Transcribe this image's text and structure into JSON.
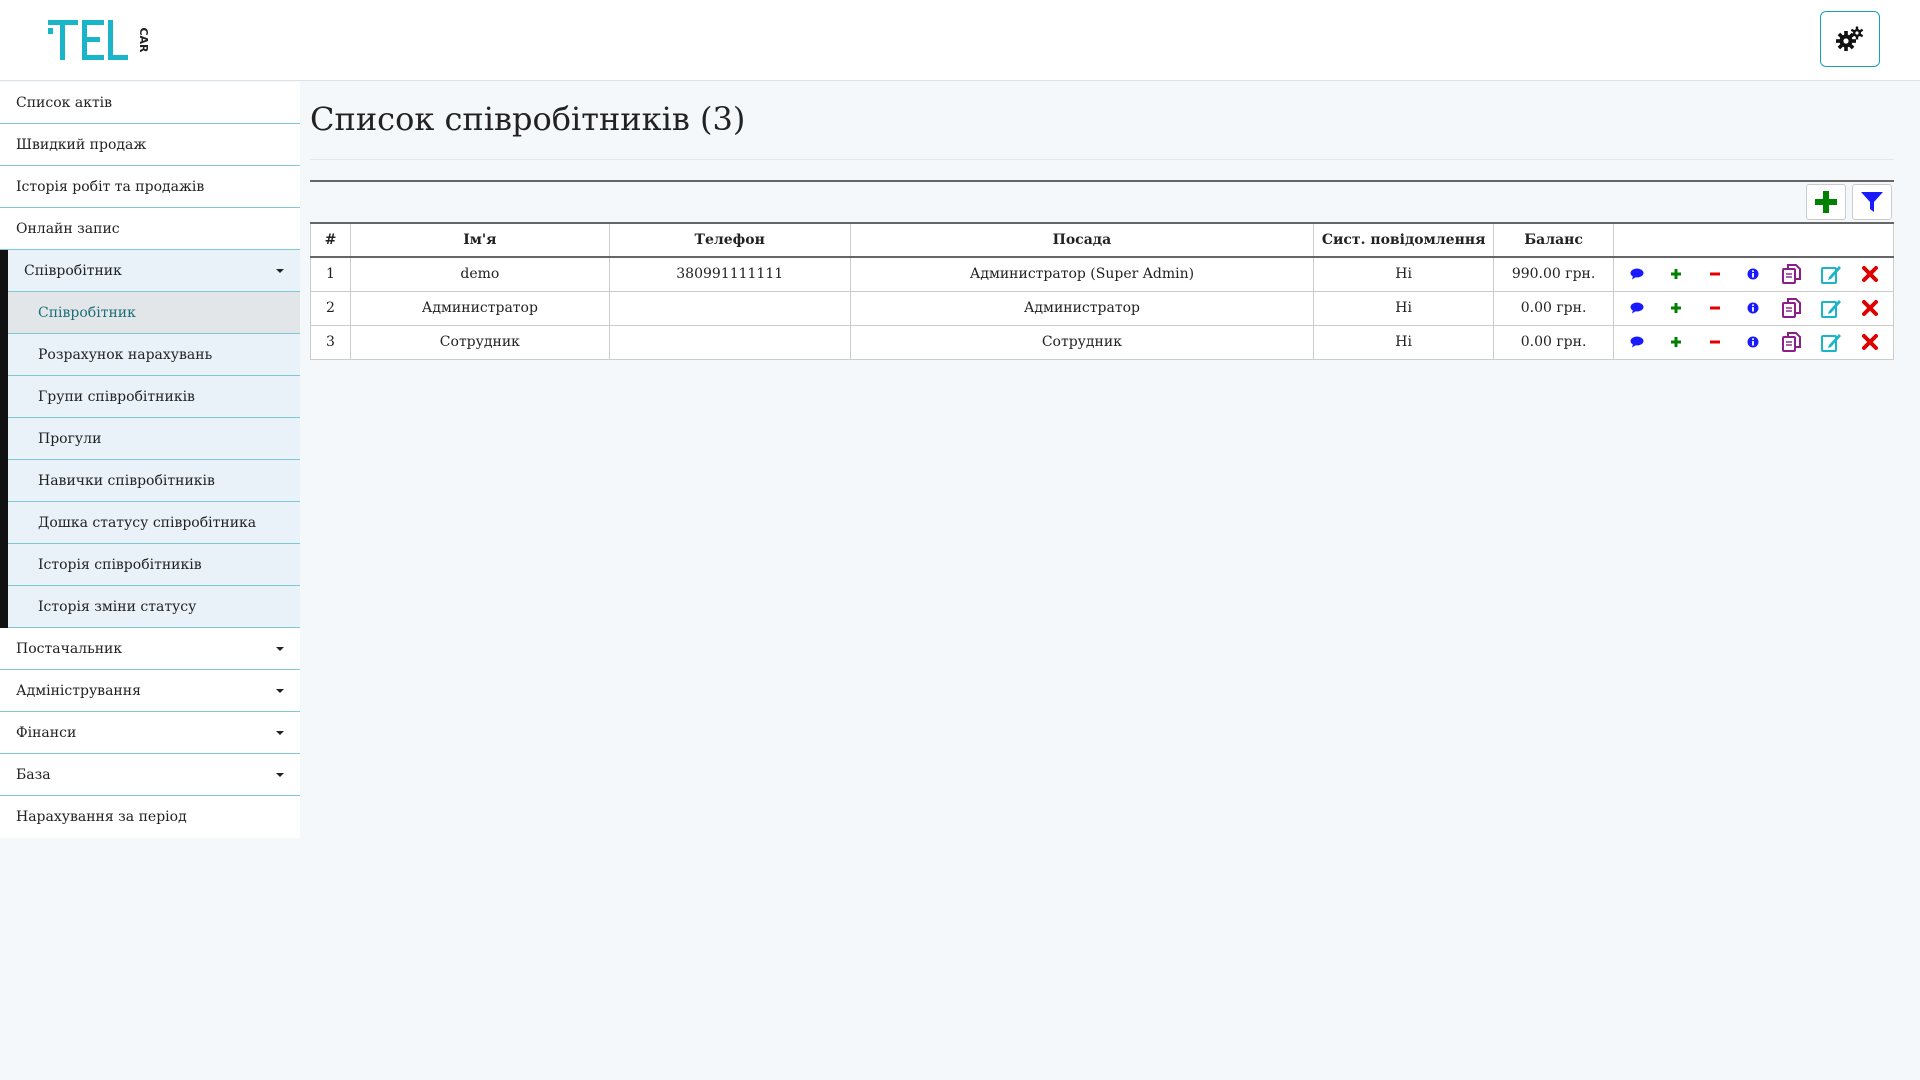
{
  "header": {
    "logo_text": "TEL",
    "logo_sub": "CAR",
    "brand_color": "#1ab5c8"
  },
  "sidebar": {
    "items": [
      {
        "label": "Список актів"
      },
      {
        "label": "Швидкий продаж"
      },
      {
        "label": "Історія робіт та продажів"
      },
      {
        "label": "Онлайн запис"
      },
      {
        "label": "Співробітник"
      },
      {
        "label": "Постачальник"
      },
      {
        "label": "Адміністрування"
      },
      {
        "label": "Фінанси"
      },
      {
        "label": "База"
      },
      {
        "label": "Нарахування за період"
      }
    ],
    "subitems": [
      {
        "label": "Співробітник"
      },
      {
        "label": "Розрахунок нарахувань"
      },
      {
        "label": "Групи співробітників"
      },
      {
        "label": "Прогули"
      },
      {
        "label": "Навички співробітників"
      },
      {
        "label": "Дошка статусу співробітника"
      },
      {
        "label": "Історія співробітників"
      },
      {
        "label": "Історія зміни статусу"
      }
    ]
  },
  "main": {
    "title": "Список співробітників (3)",
    "table": {
      "headers": [
        "#",
        "Ім'я",
        "Телефон",
        "Посада",
        "Сист. повідомлення",
        "Баланс",
        ""
      ],
      "rows": [
        {
          "num": "1",
          "name": "demo",
          "phone": "380991111111",
          "position": "Администратор (Super Admin)",
          "sys": "Ні",
          "balance": "990.00 грн."
        },
        {
          "num": "2",
          "name": "Администратор",
          "phone": "",
          "position": "Администратор",
          "sys": "Ні",
          "balance": "0.00 грн."
        },
        {
          "num": "3",
          "name": "Сотрудник",
          "phone": "",
          "position": "Сотрудник",
          "sys": "Ні",
          "balance": "0.00 грн."
        }
      ]
    }
  },
  "colors": {
    "accent": "#17a2b8",
    "add_green": "#008000",
    "filter_blue": "#1a1aff",
    "delete_red": "#e00000",
    "copy_purple": "#8b1e8b"
  }
}
